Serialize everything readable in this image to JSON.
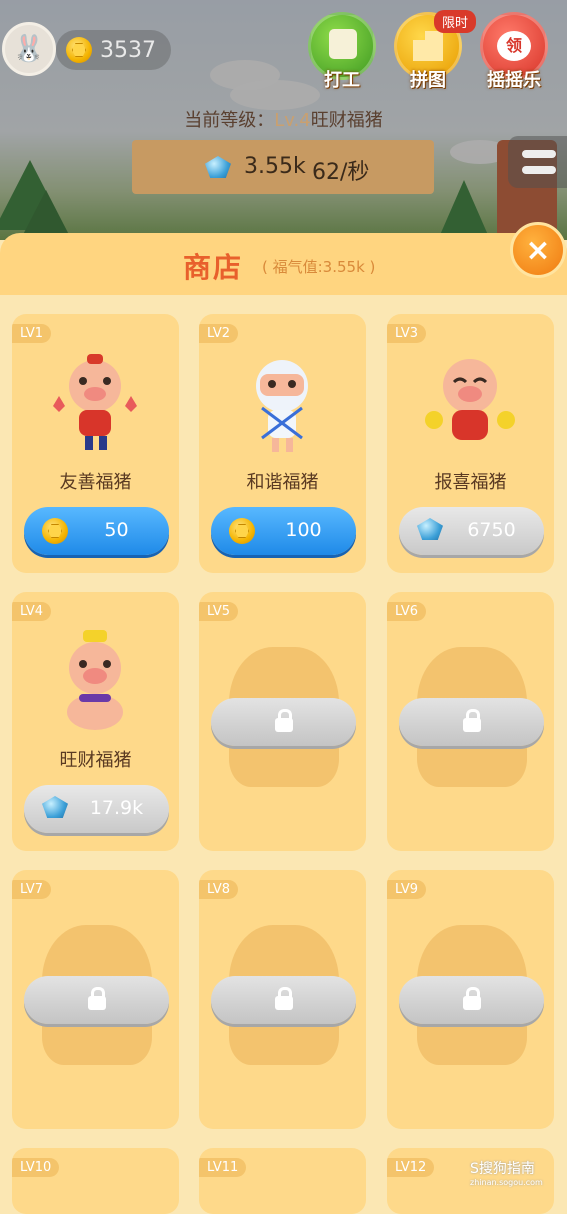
{
  "header": {
    "coin_amount": "3537",
    "buttons": [
      {
        "label": "打工",
        "icon": "work-icon"
      },
      {
        "label": "拼图",
        "icon": "puzzle-icon",
        "badge": "限时"
      },
      {
        "label": "摇摇乐",
        "icon": "shake-icon",
        "inner": "领"
      }
    ],
    "level_prefix": "当前等级：",
    "level_value": "Lv.4",
    "level_name": "旺财福猪",
    "gems_amount": "3.55k",
    "rate": "62/秒"
  },
  "shop": {
    "title": "商店",
    "subtitle": "( 福气值:3.55k )",
    "close_icon": "×"
  },
  "cards": [
    {
      "level": "LV1",
      "name": "友善福猪",
      "price": "50",
      "currency": "coin",
      "locked": false
    },
    {
      "level": "LV2",
      "name": "和谐福猪",
      "price": "100",
      "currency": "coin",
      "locked": false
    },
    {
      "level": "LV3",
      "name": "报喜福猪",
      "price": "6750",
      "currency": "gem",
      "locked": false
    },
    {
      "level": "LV4",
      "name": "旺财福猪",
      "price": "17.9k",
      "currency": "gem",
      "locked": false
    },
    {
      "level": "LV5",
      "locked": true
    },
    {
      "level": "LV6",
      "locked": true
    },
    {
      "level": "LV7",
      "locked": true
    },
    {
      "level": "LV8",
      "locked": true
    },
    {
      "level": "LV9",
      "locked": true
    },
    {
      "level": "LV10",
      "locked": true
    },
    {
      "level": "LV11",
      "locked": true
    },
    {
      "level": "LV12",
      "locked": true
    }
  ],
  "watermark": {
    "text": "S搜狗指南",
    "url": "zhinan.sogou.com"
  },
  "colors": {
    "accent": "#e8602c",
    "card": "#fed98a",
    "buy_blue": "#1f8ae8"
  }
}
